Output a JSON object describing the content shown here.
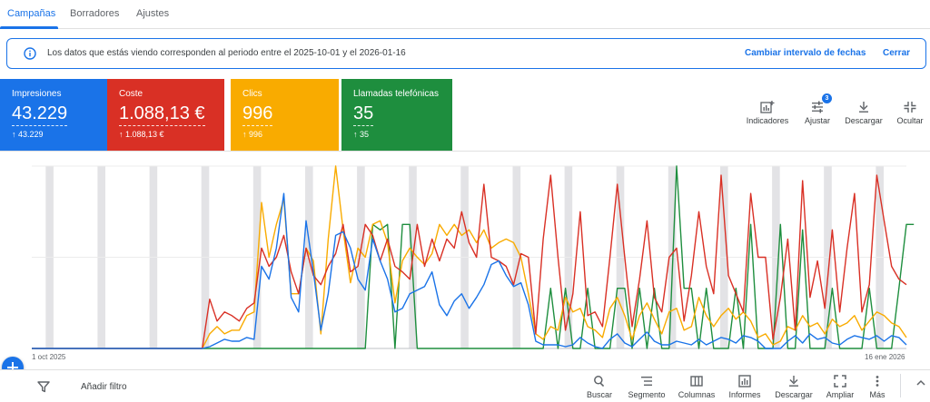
{
  "tabs": [
    {
      "label": "Campañas",
      "active": true
    },
    {
      "label": "Borradores",
      "active": false
    },
    {
      "label": "Ajustes",
      "active": false
    }
  ],
  "banner": {
    "icon": "info-icon",
    "message": "Los datos que estás viendo corresponden al periodo entre el 2025-10-01 y el 2026-01-16",
    "change_range_label": "Cambiar intervalo de fechas",
    "close_label": "Cerrar"
  },
  "metrics": [
    {
      "label": "Impresiones",
      "value": "43.229",
      "delta": "43.229",
      "color": "#1a73e8"
    },
    {
      "label": "Coste",
      "value": "1.088,13 €",
      "delta": "1.088,13 €",
      "color": "#d93025"
    },
    {
      "label": "Clics",
      "value": "996",
      "delta": "996",
      "color": "#f9ab00"
    },
    {
      "label": "Llamadas telefónicas",
      "value": "35",
      "delta": "35",
      "color": "#1e8e3e"
    }
  ],
  "toolbar": {
    "indicadores": "Indicadores",
    "ajustar": "Ajustar",
    "ajustar_badge": "3",
    "descargar": "Descargar",
    "ocultar": "Ocultar"
  },
  "chart_data": {
    "type": "line",
    "x_start_label": "1 oct 2025",
    "x_end_label": "16 ene 2026",
    "grid": true,
    "series": [
      {
        "name": "Impresiones",
        "color": "#1a73e8",
        "values": [
          0,
          0,
          0,
          0,
          0,
          0,
          0,
          0,
          0,
          0,
          0,
          0,
          0,
          0,
          0,
          0,
          0,
          0,
          0,
          0,
          0,
          0,
          0,
          0,
          0.01,
          0.03,
          0.05,
          0.04,
          0.04,
          0.06,
          0.05,
          0.45,
          0.38,
          0.55,
          0.85,
          0.28,
          0.2,
          0.7,
          0.42,
          0.1,
          0.3,
          0.62,
          0.64,
          0.55,
          0.38,
          0.32,
          0.6,
          0.48,
          0.38,
          0.2,
          0.22,
          0.3,
          0.32,
          0.34,
          0.42,
          0.24,
          0.18,
          0.26,
          0.3,
          0.22,
          0.28,
          0.35,
          0.46,
          0.48,
          0.4,
          0.34,
          0.36,
          0.24,
          0.04,
          0.02,
          0.02,
          0.02,
          0.01,
          0.02,
          0.06,
          0.03,
          0.01,
          0,
          0.05,
          0.08,
          0.03,
          0.01,
          0.05,
          0.09,
          0.04,
          0.02,
          0.02,
          0.04,
          0.03,
          0.02,
          0.05,
          0.02,
          0.04,
          0.06,
          0.05,
          0.03,
          0.07,
          0.06,
          0.04,
          0,
          0,
          0,
          0.04,
          0.07,
          0.03,
          0.08,
          0.05,
          0.06,
          0.03,
          0.02,
          0.05,
          0.07,
          0.06,
          0.05,
          0.07,
          0.04,
          0.07,
          0.06,
          0.02
        ]
      },
      {
        "name": "Coste",
        "color": "#d93025",
        "values": [
          0,
          0,
          0,
          0,
          0,
          0,
          0,
          0,
          0,
          0,
          0,
          0,
          0,
          0,
          0,
          0,
          0,
          0,
          0,
          0,
          0,
          0,
          0,
          0,
          0.27,
          0.15,
          0.2,
          0.18,
          0.15,
          0.22,
          0.25,
          0.55,
          0.45,
          0.5,
          0.62,
          0.42,
          0.3,
          0.55,
          0.4,
          0.35,
          0.45,
          0.52,
          0.68,
          0.42,
          0.45,
          0.68,
          0.62,
          0.48,
          0.6,
          0.45,
          0.42,
          0.38,
          0.68,
          0.45,
          0.6,
          0.48,
          0.6,
          0.55,
          0.75,
          0.58,
          0.5,
          0.9,
          0.5,
          0.48,
          0.45,
          0.35,
          0.52,
          0.5,
          0.08,
          0.6,
          0.95,
          0.5,
          0.1,
          0.3,
          0.75,
          0.18,
          0.2,
          0.12,
          0.5,
          0.9,
          0.5,
          0.12,
          0.38,
          0.7,
          0.28,
          0.2,
          0.5,
          0.55,
          0.15,
          0.4,
          0.75,
          0.45,
          0.3,
          0.95,
          0.4,
          0.3,
          0.2,
          0.85,
          0.5,
          0.5,
          0.05,
          0.28,
          0.6,
          0.1,
          0.92,
          0.28,
          0.48,
          0.22,
          0.65,
          0.2,
          0.55,
          0.85,
          0.2,
          0.35,
          0.95,
          0.7,
          0.45,
          0.38,
          0.35
        ]
      },
      {
        "name": "Clics",
        "color": "#f9ab00",
        "values": [
          0,
          0,
          0,
          0,
          0,
          0,
          0,
          0,
          0,
          0,
          0,
          0,
          0,
          0,
          0,
          0,
          0,
          0,
          0,
          0,
          0,
          0,
          0,
          0,
          0.08,
          0.12,
          0.08,
          0.1,
          0.1,
          0.18,
          0.2,
          0.8,
          0.5,
          0.68,
          0.82,
          0.3,
          0.3,
          0.55,
          0.48,
          0.08,
          0.6,
          1.0,
          0.65,
          0.36,
          0.55,
          0.5,
          0.68,
          0.7,
          0.58,
          0.25,
          0.48,
          0.55,
          0.5,
          0.46,
          0.52,
          0.68,
          0.62,
          0.68,
          0.62,
          0.65,
          0.58,
          0.65,
          0.55,
          0.58,
          0.6,
          0.58,
          0.5,
          0.3,
          0.08,
          0.05,
          0.12,
          0.1,
          0.28,
          0.2,
          0.22,
          0.12,
          0.1,
          0.06,
          0.22,
          0.28,
          0.18,
          0.05,
          0.18,
          0.25,
          0.16,
          0.08,
          0.2,
          0.22,
          0.1,
          0.12,
          0.28,
          0.18,
          0.12,
          0.18,
          0.22,
          0.16,
          0.2,
          0.15,
          0.06,
          0.08,
          0.02,
          0.04,
          0.12,
          0.1,
          0.18,
          0.12,
          0.14,
          0.08,
          0.16,
          0.12,
          0.14,
          0.18,
          0.1,
          0.15,
          0.2,
          0.18,
          0.14,
          0.12,
          0.06
        ]
      },
      {
        "name": "Llamadas telefónicas",
        "color": "#1e8e3e",
        "values": [
          0,
          0,
          0,
          0,
          0,
          0,
          0,
          0,
          0,
          0,
          0,
          0,
          0,
          0,
          0,
          0,
          0,
          0,
          0,
          0,
          0,
          0,
          0,
          0,
          0,
          0,
          0,
          0,
          0,
          0,
          0,
          0,
          0,
          0,
          0,
          0,
          0,
          0,
          0,
          0,
          0,
          0,
          0,
          0,
          0,
          0,
          0.68,
          0.65,
          0.68,
          0,
          0.68,
          0.68,
          0,
          0,
          0,
          0,
          0,
          0,
          0,
          0,
          0,
          0,
          0,
          0,
          0,
          0,
          0,
          0,
          0,
          0,
          0.33,
          0,
          0.33,
          0,
          0,
          0.33,
          0,
          0,
          0,
          0.33,
          0.33,
          0,
          0.33,
          0,
          0.33,
          0,
          0,
          1.0,
          0.33,
          0.33,
          0,
          0.33,
          0,
          0,
          0,
          0.33,
          0,
          0.68,
          0,
          0,
          0,
          0.68,
          0,
          0,
          0.65,
          0,
          0,
          0,
          0.33,
          0,
          0,
          0,
          0,
          0.33,
          0,
          0,
          0,
          0.33,
          0.68,
          0.68
        ]
      }
    ]
  },
  "bottom": {
    "add_filter": "Añadir filtro",
    "tools": [
      "Buscar",
      "Segmento",
      "Columnas",
      "Informes",
      "Descargar",
      "Ampliar",
      "Más"
    ]
  }
}
